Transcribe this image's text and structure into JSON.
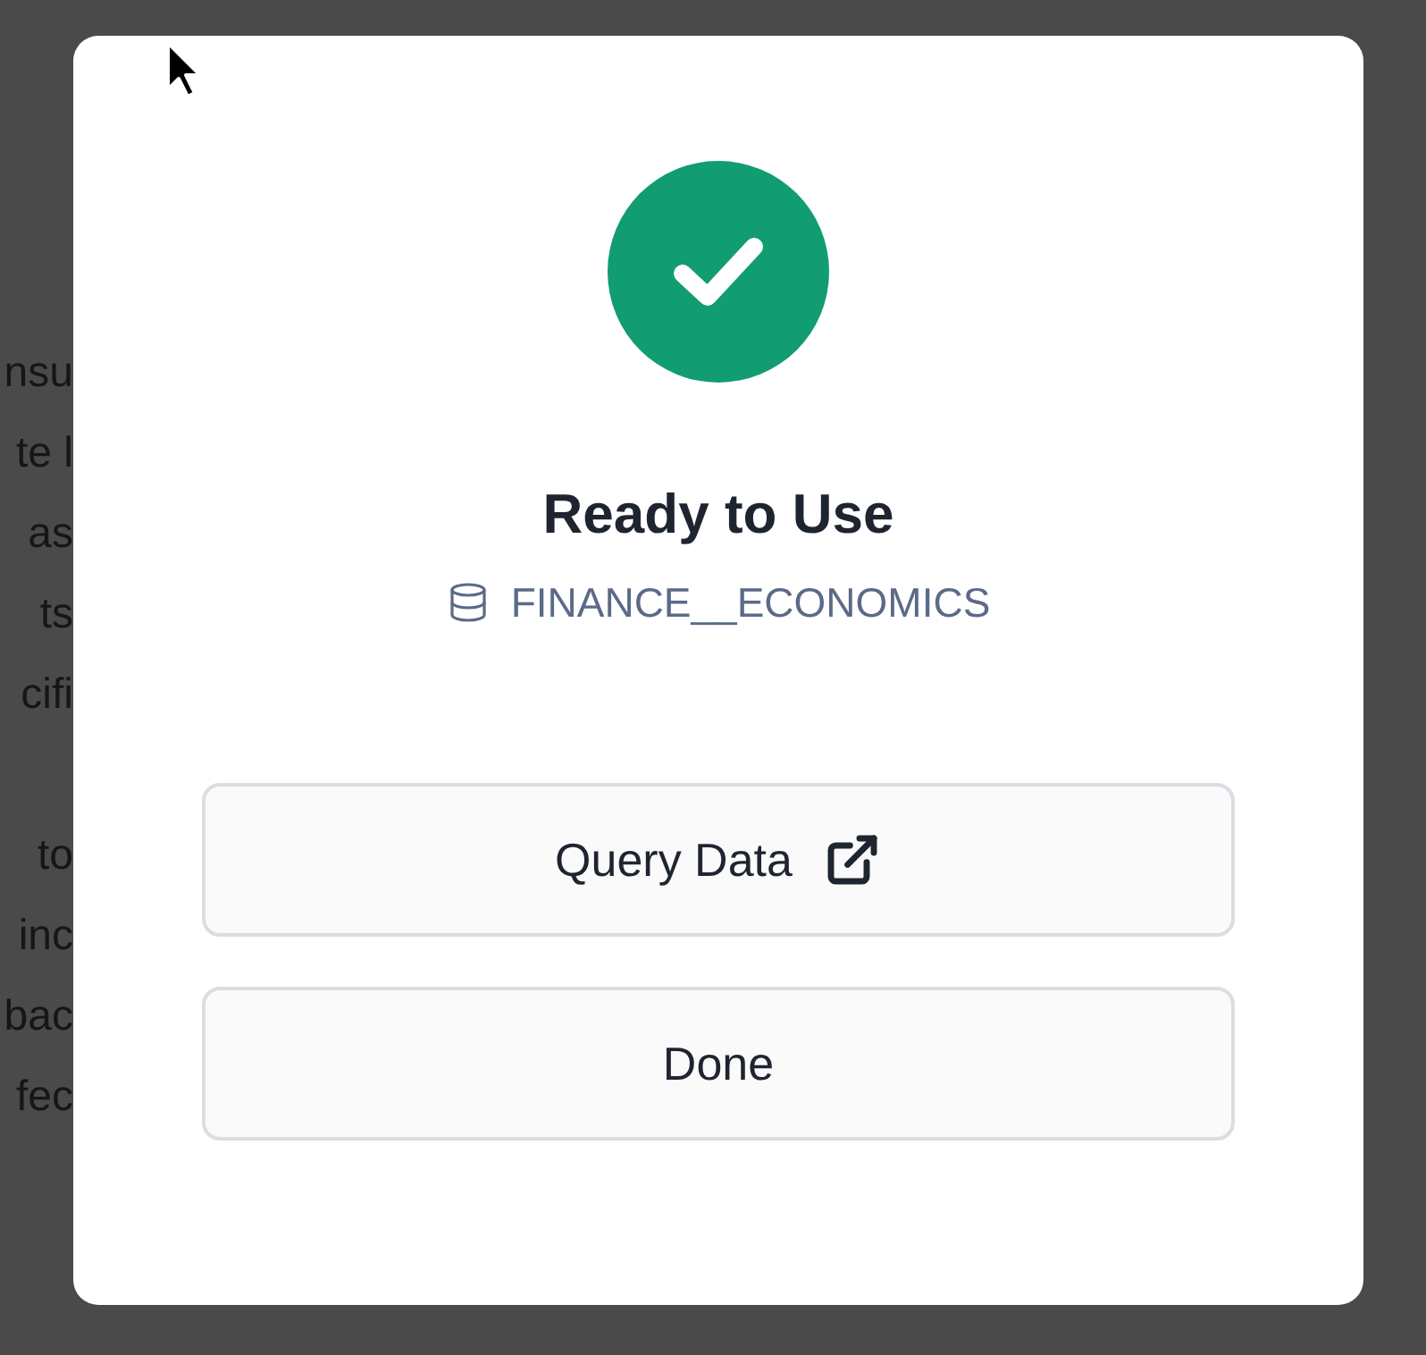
{
  "background_paragraphs": [
    [
      "nsu",
      "te l",
      "as",
      "ts",
      "cifi"
    ],
    [
      "to",
      "inc",
      "bac",
      "fec"
    ]
  ],
  "dialog": {
    "title": "Ready to Use",
    "database": "FINANCE__ECONOMICS",
    "buttons": [
      {
        "label": "Query Data",
        "kind": "external"
      },
      {
        "label": "Done",
        "kind": "plain"
      }
    ]
  }
}
